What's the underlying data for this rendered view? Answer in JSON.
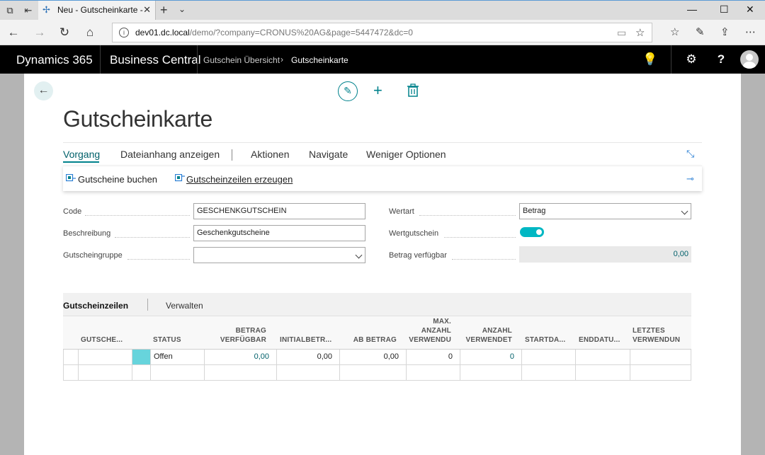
{
  "browser": {
    "tab_title": "Neu - Gutscheinkarte -",
    "url_host": "dev01.dc.local",
    "url_path": "/demo/?company=CRONUS%20AG&page=5447472&dc=0"
  },
  "topbar": {
    "product": "Dynamics 365",
    "app": "Business Central",
    "breadcrumb_parent": "Gutschein Übersicht",
    "breadcrumb_current": "Gutscheinkarte",
    "help_label": "?"
  },
  "page": {
    "title": "Gutscheinkarte"
  },
  "menu": {
    "items": [
      "Vorgang",
      "Dateianhang anzeigen",
      "Aktionen",
      "Navigate",
      "Weniger Optionen"
    ]
  },
  "actions": {
    "post": "Gutscheine buchen",
    "create_lines": "Gutscheinzeilen erzeugen"
  },
  "fields": {
    "code_label": "Code",
    "code_value": "GESCHENKGUTSCHEIN",
    "description_label": "Beschreibung",
    "description_value": "Geschenkgutscheine",
    "group_label": "Gutscheingruppe",
    "group_value": "",
    "valuetype_label": "Wertart",
    "valuetype_value": "Betrag",
    "valuevoucher_label": "Wertgutschein",
    "valuevoucher_on": true,
    "available_label": "Betrag verfügbar",
    "available_value": "0,00"
  },
  "lines": {
    "title": "Gutscheinzeilen",
    "manage": "Verwalten",
    "columns": [
      "GUTSCHE...",
      "STATUS",
      "BETRAG VERFÜGBAR",
      "INITIALBETR...",
      "AB BETRAG",
      "MAX. ANZAHL VERWENDU",
      "ANZAHL VERWENDET",
      "STARTDA...",
      "ENDDATU...",
      "LETZTES VERWENDUN"
    ],
    "column_lines": [
      [
        "GUTSCHE..."
      ],
      [
        "STATUS"
      ],
      [
        "BETRAG",
        "VERFÜGBAR"
      ],
      [
        "INITIALBETR..."
      ],
      [
        "AB BETRAG"
      ],
      [
        "MAX.",
        "ANZAHL",
        "VERWENDU"
      ],
      [
        "ANZAHL",
        "VERWENDET"
      ],
      [
        "STARTDA..."
      ],
      [
        "ENDDATU..."
      ],
      [
        "LETZTES",
        "VERWENDUN"
      ]
    ],
    "rows": [
      {
        "code": "",
        "status": "Offen",
        "available": "0,00",
        "initial": "0,00",
        "from_amount": "0,00",
        "max_uses": "0",
        "uses": "0",
        "start": "",
        "end": "",
        "last_use": ""
      },
      {
        "code": "",
        "status": "",
        "available": "",
        "initial": "",
        "from_amount": "",
        "max_uses": "",
        "uses": "",
        "start": "",
        "end": "",
        "last_use": ""
      }
    ]
  },
  "colors": {
    "accent": "#00828c",
    "link": "#00606a",
    "toggle_on": "#00b7c3",
    "selected_cell": "#67d4dc"
  }
}
